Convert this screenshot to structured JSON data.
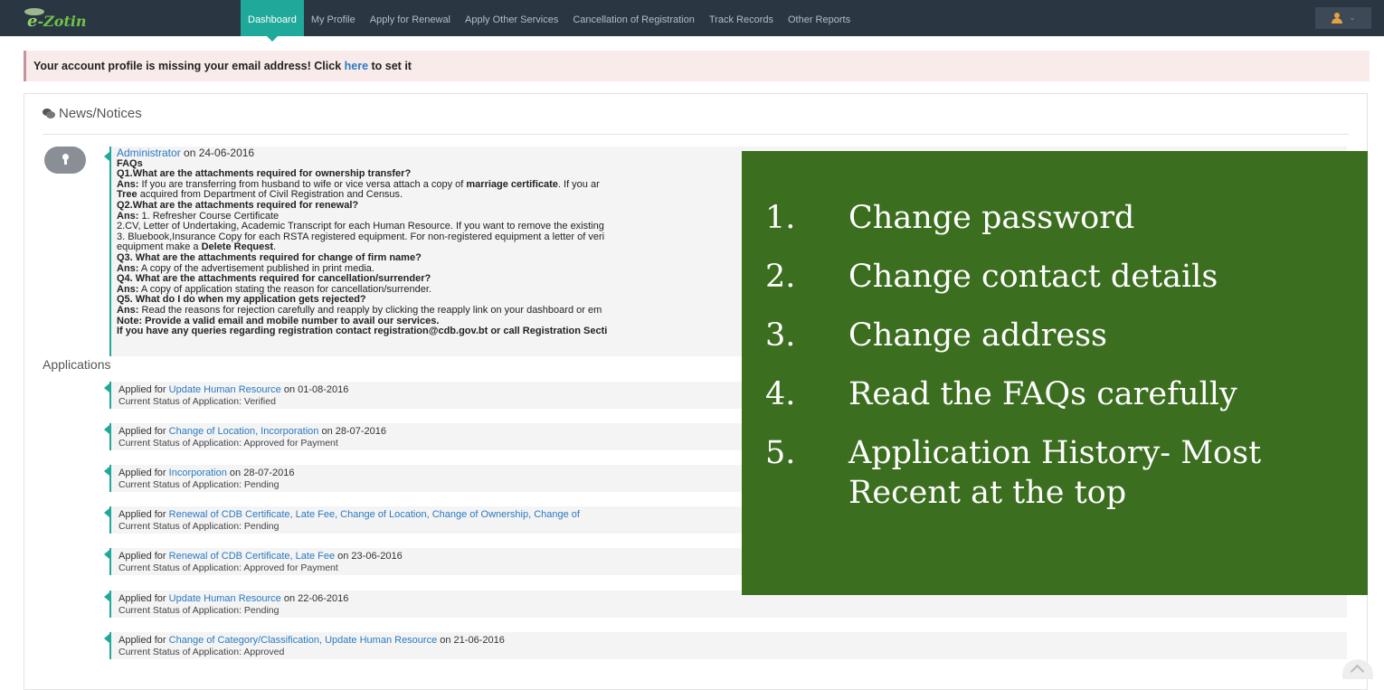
{
  "navbar": {
    "logo_prefix": "e",
    "logo_text": "-Zotin",
    "items": [
      {
        "label": "Dashboard",
        "active": true
      },
      {
        "label": "My Profile",
        "active": false
      },
      {
        "label": "Apply for Renewal",
        "active": false
      },
      {
        "label": "Apply Other Services",
        "active": false
      },
      {
        "label": "Cancellation of Registration",
        "active": false
      },
      {
        "label": "Track Records",
        "active": false
      },
      {
        "label": "Other Reports",
        "active": false
      }
    ],
    "user_icon": "user-icon",
    "accent_color": "#1fa99b",
    "bg_color": "#2b3643"
  },
  "alert": {
    "text_before": "Your account profile is missing your email address! Click ",
    "link": "here",
    "text_after": " to set it"
  },
  "news": {
    "title": "News/Notices",
    "author": "Administrator",
    "date_text": " on 24-06-2016",
    "faqs_label": "FAQs",
    "lines": [
      {
        "bold": "Q1.What are the attachments required for ownership transfer?",
        "text": ""
      },
      {
        "bold": "Ans:",
        "text": " If you are transferring from husband to wife or vice versa attach a copy of ",
        "bold2": "marriage certificate",
        "text2": ". If you ar"
      },
      {
        "bold": "Tree",
        "text": " acquired from Department of Civil Registration and Census."
      },
      {
        "bold": "Q2.What are the attachments required for renewal?",
        "text": ""
      },
      {
        "bold": "Ans:",
        "text": " 1. Refresher Course Certificate"
      },
      {
        "bold": "",
        "text": "2.CV, Letter of Undertaking, Academic Transcript for each Human Resource. If you want to remove the existing"
      },
      {
        "bold": "",
        "text": "3. Bluebook,Insurance Copy for each RSTA registered equipment. For non-registered equipment a letter of veri"
      },
      {
        "bold": "",
        "text": "equipment make a ",
        "bold2": "Delete Request",
        "text2": "."
      },
      {
        "bold": "Q3. What are the attachments required for change of firm name?",
        "text": ""
      },
      {
        "bold": "Ans:",
        "text": " A copy of the advertisement published in print media."
      },
      {
        "bold": "Q4. What are the attachments required for cancellation/surrender?",
        "text": ""
      },
      {
        "bold": "Ans:",
        "text": " A copy of application stating the reason for cancellation/surrender."
      },
      {
        "bold": "Q5. What do I do when my application gets rejected?",
        "text": ""
      },
      {
        "bold": "Ans:",
        "text": " Read the reasons for rejection carefully and reapply by clicking the reapply link on your dashboard or em"
      },
      {
        "bold": "Note: Provide a valid email and mobile number to avail our services.",
        "text": ""
      },
      {
        "bold": "If you have any queries regarding registration contact registration@cdb.gov.bt or call Registration Secti",
        "text": ""
      }
    ]
  },
  "applications": {
    "heading": "Applications",
    "applied_for_label": "Applied for ",
    "status_label": "Current Status of Application: ",
    "items": [
      {
        "services": "Update Human Resource",
        "date_text": " on 01-08-2016",
        "status": "Verified"
      },
      {
        "services": "Change of Location, Incorporation",
        "date_text": " on 28-07-2016",
        "status": "Approved for Payment"
      },
      {
        "services": "Incorporation",
        "date_text": " on 28-07-2016",
        "status": "Pending"
      },
      {
        "services": "Renewal of CDB Certificate, Late Fee, Change of Location, Change of Ownership, Change of",
        "date_text": "",
        "status": "Pending"
      },
      {
        "services": "Renewal of CDB Certificate, Late Fee",
        "date_text": " on 23-06-2016",
        "status": "Approved for Payment"
      },
      {
        "services": "Update Human Resource",
        "date_text": " on 22-06-2016",
        "status": "Pending"
      },
      {
        "services": "Change of Category/Classification, Update Human Resource",
        "date_text": " on 21-06-2016",
        "status": "Approved"
      }
    ]
  },
  "overlay": {
    "bg_color": "#3c6e20",
    "items": [
      {
        "num": "1.",
        "text": "Change password"
      },
      {
        "num": "2.",
        "text": "Change contact details"
      },
      {
        "num": "3.",
        "text": "Change address"
      },
      {
        "num": "4.",
        "text": "Read the FAQs carefully"
      },
      {
        "num": "5.",
        "text": "Application History- Most Recent at the top"
      }
    ]
  }
}
